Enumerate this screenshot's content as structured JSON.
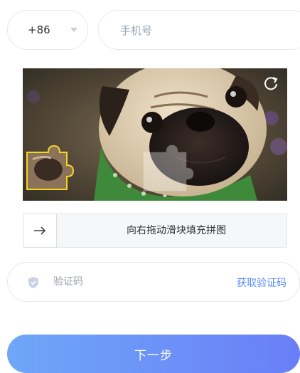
{
  "phone": {
    "country_code": "+86",
    "placeholder": "手机号"
  },
  "captcha": {
    "image": "pug-dog-photo",
    "refresh_icon": "refresh-icon"
  },
  "slider": {
    "arrow_icon": "arrow-right-icon",
    "hint": "向右拖动滑块填充拼图"
  },
  "code": {
    "placeholder": "验证码",
    "get_code_label": "获取验证码",
    "shield_icon": "shield-icon"
  },
  "next_button": {
    "label": "下一步"
  },
  "colors": {
    "accent": "#5b8cf7",
    "button_start": "#6ea7f8",
    "button_end": "#6a7ef7"
  }
}
